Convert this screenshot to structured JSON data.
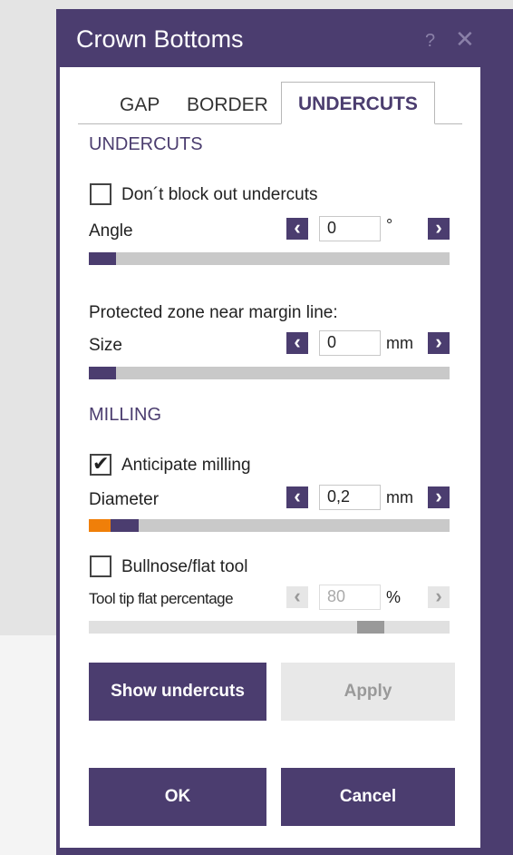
{
  "title": "Crown Bottoms",
  "title_buttons": {
    "help": "?",
    "close": "✕"
  },
  "tabs": [
    {
      "label": "GAP"
    },
    {
      "label": "BORDER"
    },
    {
      "label": "UNDERCUTS",
      "active": true
    }
  ],
  "undercuts": {
    "heading": "UNDERCUTS",
    "dont_block": {
      "label": "Don´t block out undercuts",
      "checked": false
    },
    "angle": {
      "label": "Angle",
      "value": "0",
      "unit": "°",
      "slider_fraction": 0
    },
    "protected_heading": "Protected zone near margin line:",
    "size": {
      "label": "Size",
      "value": "0",
      "unit": "mm",
      "slider_fraction": 0
    }
  },
  "milling": {
    "heading": "MILLING",
    "anticipate": {
      "label": "Anticipate milling",
      "checked": true
    },
    "diameter": {
      "label": "Diameter",
      "value": "0,2",
      "unit": "mm",
      "slider_fraction": 0.14
    },
    "bullnose": {
      "label": "Bullnose/flat tool",
      "checked": false
    },
    "tip_flat": {
      "label": "Tool tip flat percentage",
      "value": "80",
      "unit": "%",
      "slider_fraction": 0.8,
      "enabled": false
    }
  },
  "buttons": {
    "show_undercuts": "Show undercuts",
    "apply": "Apply",
    "ok": "OK",
    "cancel": "Cancel"
  },
  "arrows": {
    "left": "‹",
    "right": "›"
  },
  "colors": {
    "accent": "#4b3d6f",
    "marker": "#f07f09",
    "disabled": "#e8e8e8"
  }
}
